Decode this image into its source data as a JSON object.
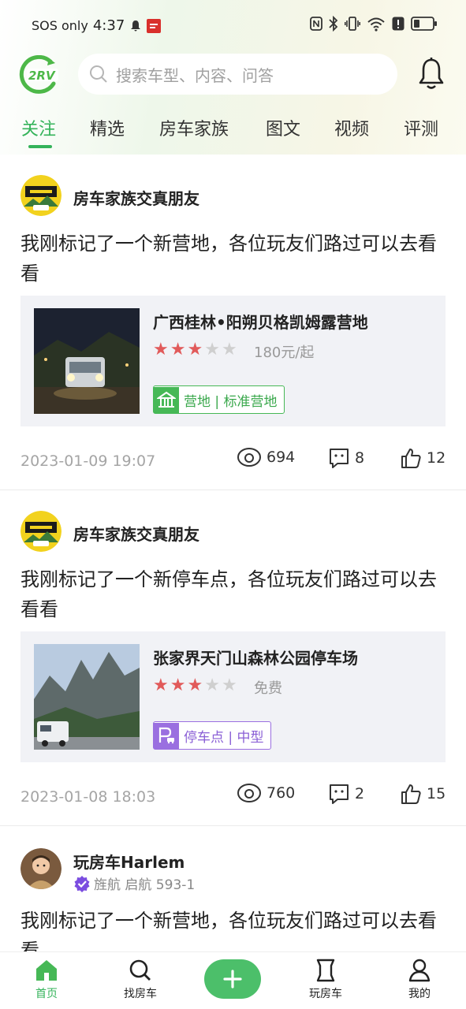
{
  "status_bar": {
    "carrier": "SOS only",
    "time": "4:37"
  },
  "header": {
    "logo_text": "2RV",
    "search_placeholder": "搜索车型、内容、问答"
  },
  "tabs": [
    {
      "label": "关注",
      "active": true
    },
    {
      "label": "精选",
      "active": false
    },
    {
      "label": "房车家族",
      "active": false
    },
    {
      "label": "图文",
      "active": false
    },
    {
      "label": "视频",
      "active": false
    },
    {
      "label": "评测",
      "active": false
    }
  ],
  "posts": [
    {
      "author": "房车家族交真朋友",
      "text": "我刚标记了一个新营地，各位玩友们路过可以去看看",
      "card": {
        "title": "广西桂林•阳朔贝格凯姆露营地",
        "rating": 3,
        "price": "180元/起",
        "tag": "营地 | 标准营地"
      },
      "date": "2023-01-09 19:07",
      "views": "694",
      "comments": "8",
      "likes": "12"
    },
    {
      "author": "房车家族交真朋友",
      "text": "我刚标记了一个新停车点，各位玩友们路过可以去看看",
      "card": {
        "title": "张家界天门山森林公园停车场",
        "rating": 3,
        "price": "免费",
        "tag": "停车点 | 中型"
      },
      "date": "2023-01-08 18:03",
      "views": "760",
      "comments": "2",
      "likes": "15"
    },
    {
      "author": "玩房车Harlem",
      "badge": "旌航 启航 593-1",
      "text": "我刚标记了一个新营地，各位玩友们路过可以去看看"
    }
  ],
  "bottom_nav": [
    {
      "label": "首页",
      "icon": "home-icon",
      "active": true
    },
    {
      "label": "找房车",
      "icon": "search-icon",
      "active": false
    },
    {
      "label": "",
      "icon": "plus-icon",
      "active": false
    },
    {
      "label": "玩房车",
      "icon": "scroll-icon",
      "active": false
    },
    {
      "label": "我的",
      "icon": "user-icon",
      "active": false
    }
  ],
  "colors": {
    "accent": "#34b35a",
    "star_on": "#e15a5a",
    "tag_camp": "#46b856",
    "tag_parking": "#9a6fe0"
  }
}
